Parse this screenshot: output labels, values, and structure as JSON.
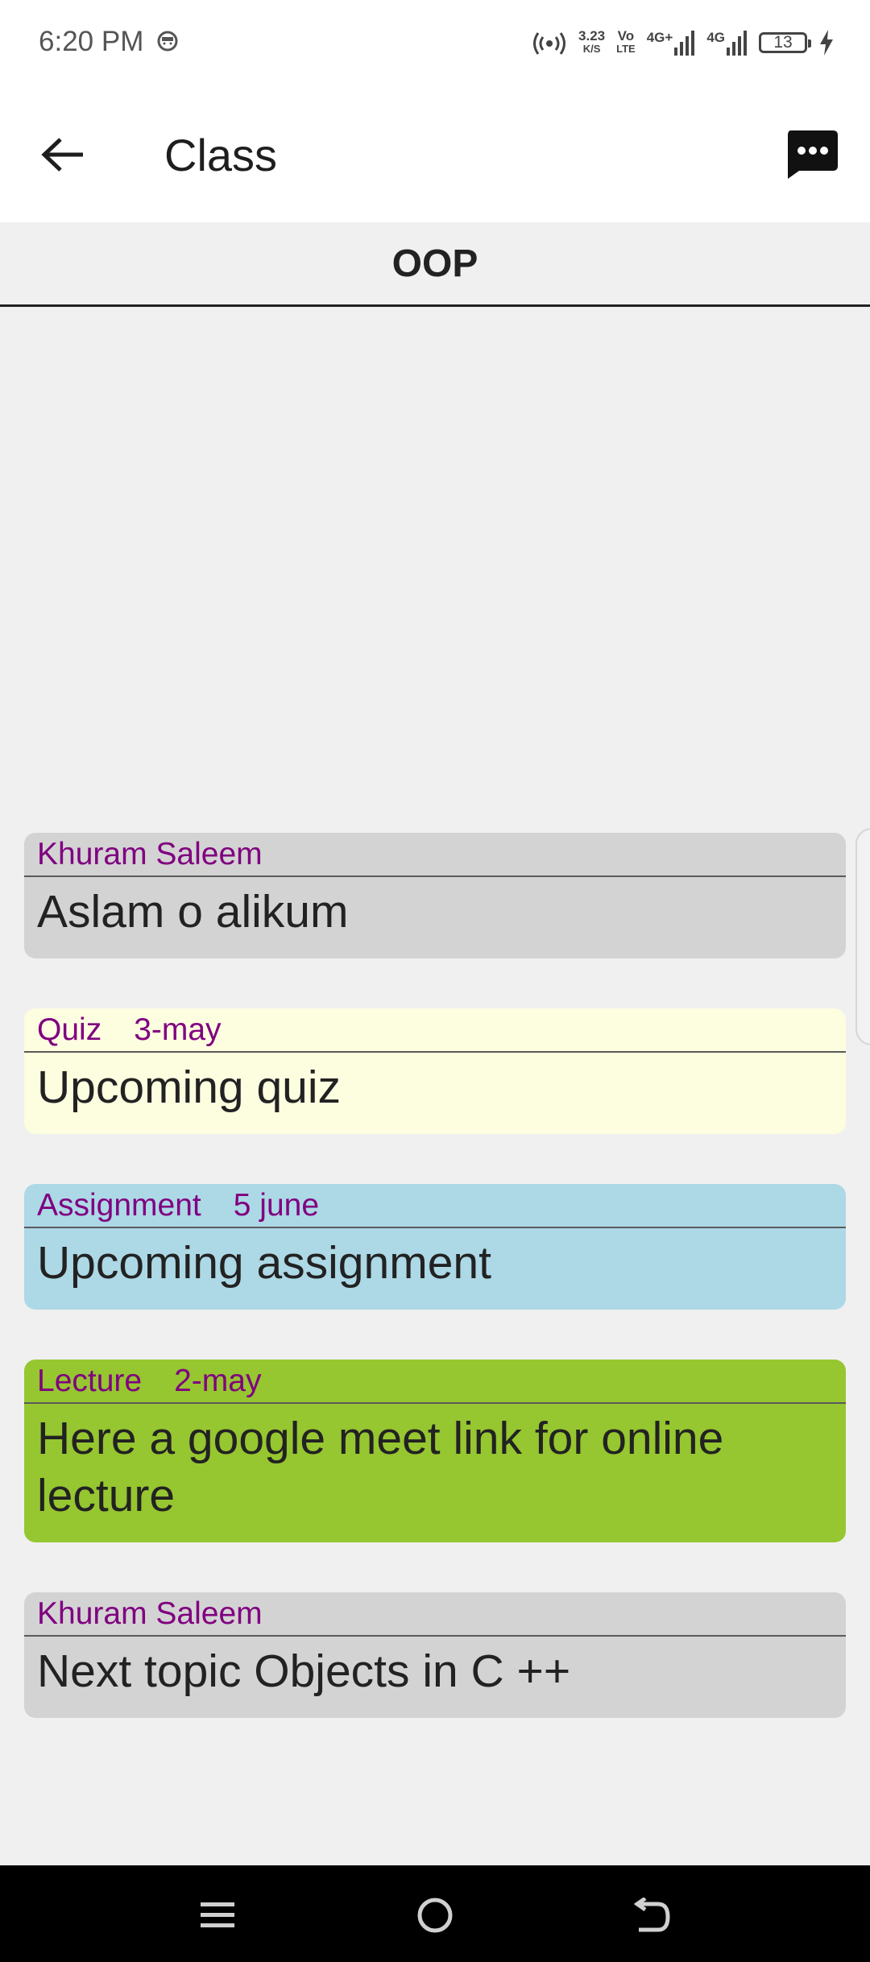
{
  "status_bar": {
    "time": "6:20 PM",
    "net_speed_top": "3.23",
    "net_speed_bottom": "K/S",
    "volte_top": "Vo",
    "volte_bottom": "LTE",
    "net_type_1": "4G+",
    "net_type_2": "4G",
    "battery_level": "13"
  },
  "app_bar": {
    "title": "Class"
  },
  "class_name": "OOP",
  "posts": [
    {
      "author": "Khuram Saleem",
      "date": "",
      "message": "Aslam o alikum",
      "color": "#d3d3d3"
    },
    {
      "author": "Quiz",
      "date": "3-may",
      "message": "Upcoming quiz",
      "color": "#fdfde0"
    },
    {
      "author": "Assignment",
      "date": "5 june",
      "message": "Upcoming assignment",
      "color": "#add8e6"
    },
    {
      "author": "Lecture",
      "date": "2-may",
      "message": "Here a google meet link for online lecture",
      "color": "#96c630"
    },
    {
      "author": "Khuram Saleem",
      "date": "",
      "message": "Next topic Objects in C ++",
      "color": "#d3d3d3"
    }
  ],
  "colors": {
    "header_text": "#800080",
    "background": "#f0f0f0"
  },
  "icons": {
    "back": "arrow-back-icon",
    "chat": "chat-bubble-icon",
    "nav_menu": "menu-icon",
    "nav_home": "home-circle-icon",
    "nav_back": "return-icon"
  }
}
